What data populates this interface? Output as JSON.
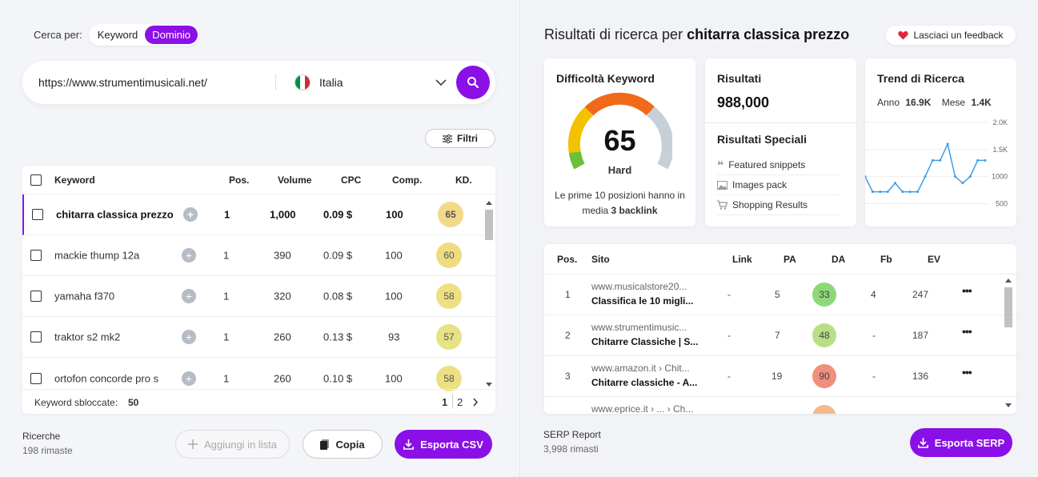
{
  "search": {
    "mode_label": "Cerca per:",
    "modes": [
      "Keyword",
      "Dominio"
    ],
    "active_mode": "Dominio",
    "url_value": "https://www.strumentimusicali.net/",
    "country": "Italia",
    "filters_label": "Filtri"
  },
  "keywords": {
    "headers": [
      "Keyword",
      "Pos.",
      "Volume",
      "CPC",
      "Comp.",
      "KD."
    ],
    "rows": [
      {
        "keyword": "chitarra classica prezzo",
        "pos": "1",
        "volume": "1,000",
        "cpc": "0.09 $",
        "comp": "100",
        "kd": "65",
        "kd_color": "#f3d98a"
      },
      {
        "keyword": "mackie thump 12a",
        "pos": "1",
        "volume": "390",
        "cpc": "0.09 $",
        "comp": "100",
        "kd": "60",
        "kd_color": "#eedc82"
      },
      {
        "keyword": "yamaha f370",
        "pos": "1",
        "volume": "320",
        "cpc": "0.08 $",
        "comp": "100",
        "kd": "58",
        "kd_color": "#ece083"
      },
      {
        "keyword": "traktor s2 mk2",
        "pos": "1",
        "volume": "260",
        "cpc": "0.13 $",
        "comp": "93",
        "kd": "57",
        "kd_color": "#e6e285"
      },
      {
        "keyword": "ortofon concorde pro s",
        "pos": "1",
        "volume": "260",
        "cpc": "0.10 $",
        "comp": "100",
        "kd": "58",
        "kd_color": "#ece083"
      }
    ],
    "unlocked_label": "Keyword sbloccate:",
    "unlocked_count": "50",
    "pages": [
      "1",
      "2"
    ],
    "current_page": "1"
  },
  "bottom_left": {
    "searches_label": "Ricerche",
    "searches_remaining": "198 rimaste",
    "add_list": "Aggiungi in lista",
    "copy": "Copia",
    "export_csv": "Esporta CSV"
  },
  "results": {
    "title_prefix": "Risultati di ricerca per",
    "query": "chitarra classica prezzo",
    "feedback": "Lasciaci un feedback"
  },
  "difficulty": {
    "title": "Difficoltà Keyword",
    "value": 65,
    "level": "Hard",
    "note_1": "Le prime 10 posizioni hanno in",
    "note_2": "media",
    "backlinks": "3 backlink"
  },
  "result_stats": {
    "results_title": "Risultati",
    "results_count": "988,000",
    "special_title": "Risultati Speciali",
    "special_items": [
      {
        "label": "Featured snippets",
        "icon": "quote-icon"
      },
      {
        "label": "Images pack",
        "icon": "image-icon"
      },
      {
        "label": "Shopping Results",
        "icon": "cart-icon"
      }
    ]
  },
  "trend": {
    "title": "Trend di Ricerca",
    "year_label": "Anno",
    "year_value": "16.9K",
    "month_label": "Mese",
    "month_value": "1.4K"
  },
  "chart_data": {
    "type": "line",
    "y_ticks": [
      "2.0K",
      "1.5K",
      "1000",
      "500"
    ],
    "ylim": [
      300,
      2000
    ],
    "values": [
      1000,
      720,
      720,
      720,
      880,
      720,
      720,
      720,
      1000,
      1300,
      1300,
      1600,
      1000,
      880,
      1000,
      1300,
      1300
    ]
  },
  "serp": {
    "headers": [
      "Pos.",
      "Sito",
      "Link",
      "PA",
      "DA",
      "Fb",
      "EV"
    ],
    "rows": [
      {
        "pos": "1",
        "url": "www.musicalstore20...",
        "title": "Classifica le 10 migli...",
        "link": "-",
        "pa": "5",
        "da": "33",
        "da_color": "#8fd87a",
        "fb": "4",
        "ev": "247"
      },
      {
        "pos": "2",
        "url": "www.strumentimusic...",
        "title": "Chitarre Classiche | S...",
        "link": "-",
        "pa": "7",
        "da": "48",
        "da_color": "#b8df86",
        "fb": "-",
        "ev": "187"
      },
      {
        "pos": "3",
        "url": "www.amazon.it › Chit...",
        "title": "Chitarre classiche - A...",
        "link": "-",
        "pa": "19",
        "da": "90",
        "da_color": "#ef8f7c",
        "fb": "-",
        "ev": "136"
      },
      {
        "pos": "",
        "url": "www.eprice.it › ... › Ch...",
        "title": "",
        "link": "",
        "pa": "",
        "da": "",
        "da_color": "#f3b98a",
        "fb": "",
        "ev": ""
      }
    ],
    "report_label": "SERP Report",
    "report_remaining": "3,998 rimasti",
    "export_label": "Esporta SERP"
  },
  "colors": {
    "accent": "#8b10e8"
  }
}
